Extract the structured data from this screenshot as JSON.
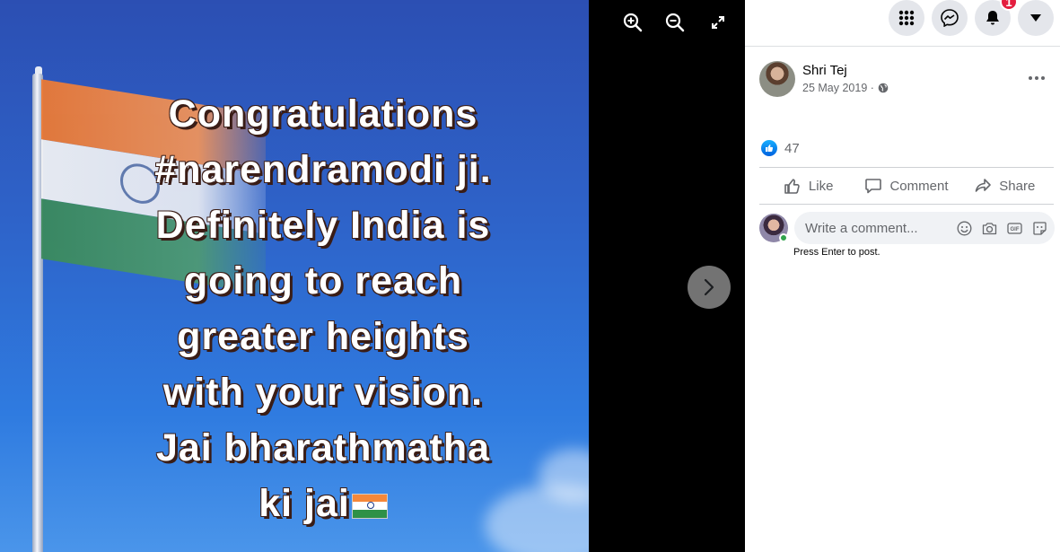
{
  "photo": {
    "text": "Congratulations\n#narendramodi ji.\nDefinitely India is\ngoing to reach\ngreater heights\nwith your vision.\nJai bharathmatha\nki jai"
  },
  "viewer_tools": {
    "zoom_in_icon": "zoom-in-icon",
    "zoom_out_icon": "zoom-out-icon",
    "fullscreen_icon": "fullscreen-icon",
    "next_icon": "chevron-right-icon"
  },
  "topbar": {
    "notifications_count": "1"
  },
  "post": {
    "author": "Shri Tej",
    "date": "25 May 2019 ·",
    "reaction_count": "47"
  },
  "actions": {
    "like": "Like",
    "comment": "Comment",
    "share": "Share"
  },
  "comment": {
    "placeholder": "Write a comment...",
    "hint": "Press Enter to post."
  },
  "colors": {
    "accent_blue": "#1877f2",
    "notification_red": "#e41e3f",
    "online_green": "#31a24c"
  }
}
